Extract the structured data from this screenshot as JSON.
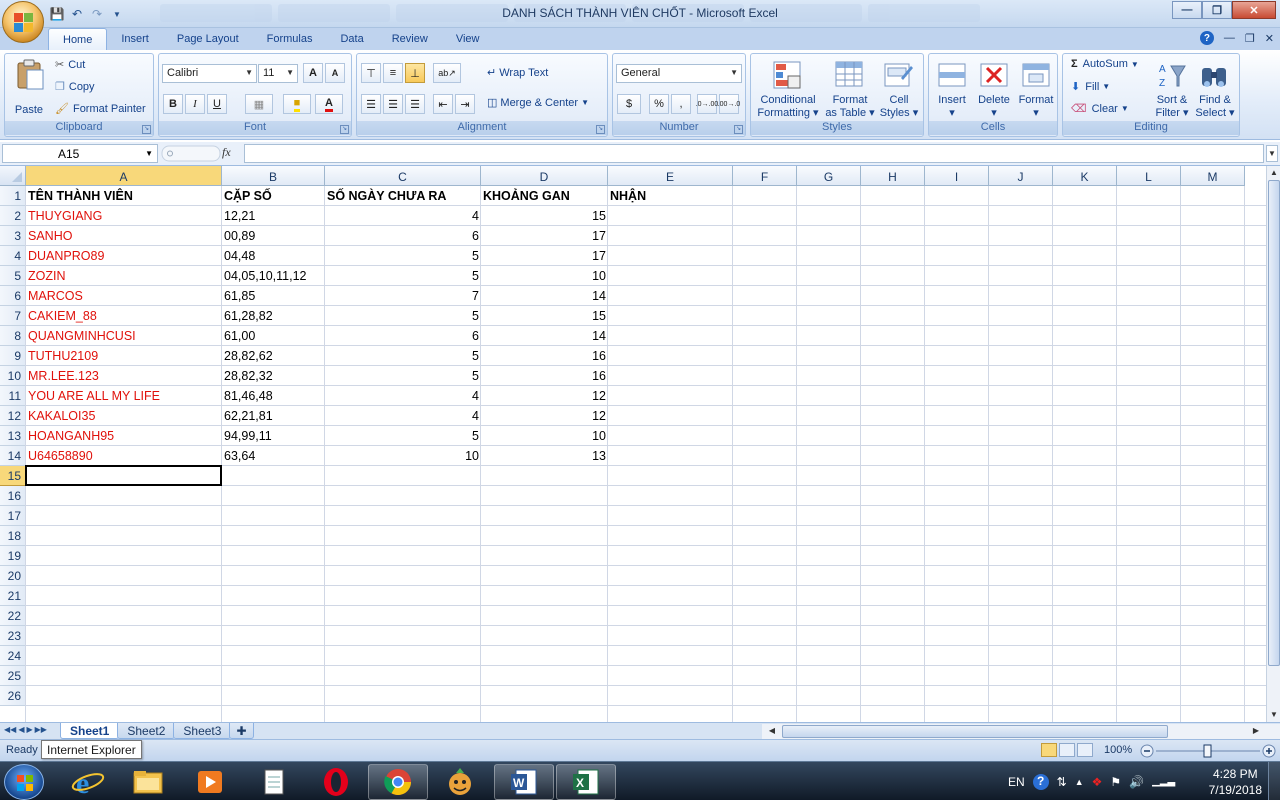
{
  "window": {
    "title": "DANH SÁCH THÀNH VIÊN CHỐT - Microsoft Excel",
    "controls": [
      "minimize",
      "restore",
      "close"
    ]
  },
  "ribbon_tabs": [
    "Home",
    "Insert",
    "Page Layout",
    "Formulas",
    "Data",
    "Review",
    "View"
  ],
  "ribbon": {
    "clipboard": {
      "label": "Clipboard",
      "paste": "Paste",
      "cut": "Cut",
      "copy": "Copy",
      "format_painter": "Format Painter"
    },
    "font": {
      "label": "Font",
      "family": "Calibri",
      "size": "11",
      "bold": "B",
      "italic": "I",
      "underline": "U",
      "grow": "A",
      "shrink": "A",
      "color": "A"
    },
    "alignment": {
      "label": "Alignment",
      "wrap_text": "Wrap Text",
      "merge_center": "Merge & Center"
    },
    "number": {
      "label": "Number",
      "format": "General",
      "currency": "$",
      "percent": "%",
      "comma": ",",
      "inc_decimal": ".0→.00",
      "dec_decimal": ".00→.0"
    },
    "styles": {
      "label": "Styles",
      "conditional": [
        "Conditional",
        "Formatting"
      ],
      "format_table": [
        "Format",
        "as Table"
      ],
      "cell_styles": [
        "Cell",
        "Styles"
      ]
    },
    "cells": {
      "label": "Cells",
      "insert": "Insert",
      "delete": "Delete",
      "format": "Format"
    },
    "editing": {
      "label": "Editing",
      "autosum": "AutoSum",
      "fill": "Fill",
      "clear": "Clear",
      "sort": [
        "Sort &",
        "Filter"
      ],
      "find": [
        "Find &",
        "Select"
      ]
    }
  },
  "formula_bar": {
    "name_box": "A15",
    "fx": "fx",
    "formula": ""
  },
  "columns": [
    "A",
    "B",
    "C",
    "D",
    "E",
    "F",
    "G",
    "H",
    "I",
    "J",
    "K",
    "L",
    "M"
  ],
  "row_numbers": [
    "1",
    "2",
    "3",
    "4",
    "5",
    "6",
    "7",
    "8",
    "9",
    "10",
    "11",
    "12",
    "13",
    "14",
    "15",
    "16",
    "17",
    "18",
    "19",
    "20",
    "21",
    "22",
    "23",
    "24",
    "25",
    "26"
  ],
  "headers": [
    "TÊN THÀNH VIÊN",
    "CẶP SỐ",
    "SỐ NGÀY CHƯA RA",
    "KHOẢNG GAN",
    "NHẬN"
  ],
  "rows": [
    [
      "THUYGIANG",
      "12,21",
      "4",
      "15"
    ],
    [
      "SANHO",
      "00,89",
      "6",
      "17"
    ],
    [
      "DUANPRO89",
      "04,48",
      "5",
      "17"
    ],
    [
      "ZOZIN",
      "04,05,10,11,12",
      "5",
      "10"
    ],
    [
      "MARCOS",
      "61,85",
      "7",
      "14"
    ],
    [
      "CAKIEM_88",
      "61,28,82",
      "5",
      "15"
    ],
    [
      "QUANGMINHCUSI",
      "61,00",
      "6",
      "14"
    ],
    [
      "TUTHU2109",
      "28,82,62",
      "5",
      "16"
    ],
    [
      "MR.LEE.123",
      "28,82,32",
      "5",
      "16"
    ],
    [
      "YOU ARE ALL MY LIFE",
      "81,46,48",
      "4",
      "12"
    ],
    [
      "KAKALOI35",
      "62,21,81",
      "4",
      "12"
    ],
    [
      "HOANGANH95",
      "94,99,11",
      "5",
      "10"
    ],
    [
      "U64658890",
      "63,64",
      "10",
      "13"
    ]
  ],
  "sheets": [
    "Sheet1",
    "Sheet2",
    "Sheet3"
  ],
  "active_sheet": "Sheet1",
  "status": {
    "ready": "Ready",
    "tooltip": "Internet Explorer",
    "zoom": "100%"
  },
  "taskbar": {
    "language": "EN",
    "time": "4:28 PM",
    "date": "7/19/2018"
  },
  "colors": {
    "name_text": "#e0110b",
    "selection_header": "#f8d87a",
    "ribbon_text": "#15428b"
  }
}
